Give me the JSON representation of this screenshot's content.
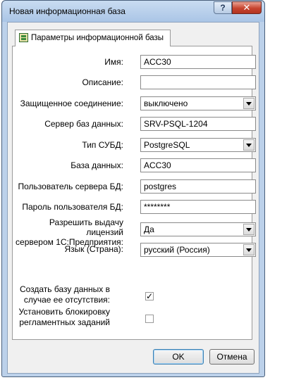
{
  "window": {
    "title": "Новая информационная база",
    "help_label": "?",
    "close_label": "✕"
  },
  "tab": {
    "icon": "infobase-params-icon",
    "label": "Параметры информационной базы"
  },
  "fields": {
    "name": {
      "label": "Имя:",
      "value": "ACC30"
    },
    "description": {
      "label": "Описание:",
      "value": ""
    },
    "secure_connection": {
      "label": "Защищенное соединение:",
      "value": "выключено"
    },
    "db_server": {
      "label": "Сервер баз данных:",
      "value": "SRV-PSQL-1204"
    },
    "dbms_type": {
      "label": "Тип СУБД:",
      "value": "PostgreSQL"
    },
    "database": {
      "label": "База данных:",
      "value": "ACC30"
    },
    "db_user": {
      "label": "Пользователь сервера БД:",
      "value": "postgres"
    },
    "db_password": {
      "label": "Пароль пользователя БД:",
      "value": "********"
    },
    "license_issue": {
      "label_line1": "Разрешить выдачу лицензий",
      "label_line2": "сервером 1С:Предприятия:",
      "value": "Да"
    },
    "language": {
      "label": "Язык (Страна):",
      "value": "русский (Россия)"
    }
  },
  "checkboxes": {
    "create_db": {
      "label_line1": "Создать базу данных в",
      "label_line2": "случае ее отсутствия:",
      "checked": true,
      "mark": "✓"
    },
    "block_tasks": {
      "label_line1": "Установить блокировку",
      "label_line2": "регламентных заданий",
      "checked": false,
      "mark": ""
    }
  },
  "buttons": {
    "ok": "OK",
    "cancel": "Отмена"
  }
}
